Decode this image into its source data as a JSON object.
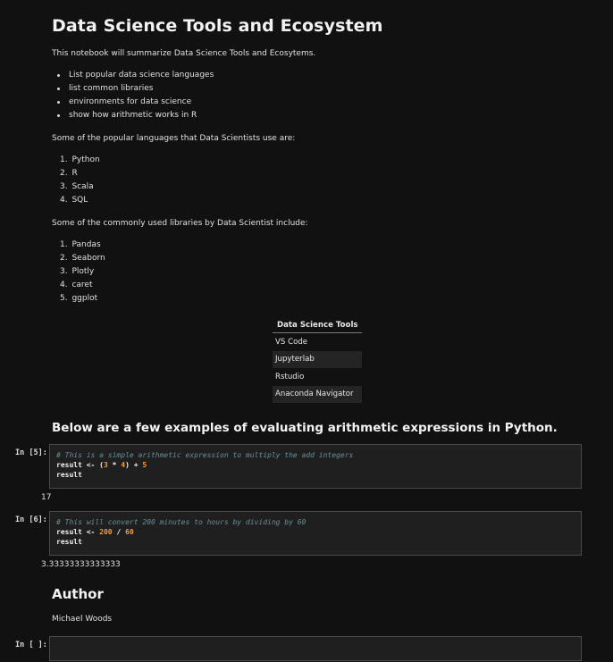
{
  "notebook": {
    "title": "Data Science Tools and Ecosystem",
    "intro": "This notebook will summarize Data Science Tools and Ecosytems.",
    "objectives": [
      "List popular data science languages",
      "list common libraries",
      "environments for data science",
      "show how arithmetic works in R"
    ],
    "languages_intro": "Some of the popular languages that Data Scientists use are:",
    "languages": [
      "Python",
      "R",
      "Scala",
      "SQL"
    ],
    "libraries_intro": "Some of the commonly used libraries by Data Scientist include:",
    "libraries": [
      "Pandas",
      "Seaborn",
      "Plotly",
      "caret",
      "ggplot"
    ],
    "tools_table": {
      "header": "Data Science Tools",
      "rows": [
        "VS Code",
        "Jupyterlab",
        "Rstudio",
        "Anaconda Navigator"
      ]
    },
    "arith_heading": "Below are a few examples of evaluating arithmetic expressions in Python.",
    "cells": [
      {
        "prompt": "In [5]:",
        "comment": "# This is a simple arithmetic expression to multiply the add integers",
        "line2": [
          "result <- ",
          "(",
          "3",
          " * ",
          "4",
          ") + ",
          "5"
        ],
        "line3": "result",
        "output": "17"
      },
      {
        "prompt": "In [6]:",
        "comment": "# This will convert 200 minutes to hours by dividing by 60",
        "line2": [
          "result <- ",
          "200",
          " / ",
          "60"
        ],
        "line3": "result",
        "output": "3.33333333333333"
      }
    ],
    "author_heading": "Author",
    "author_name": "Michael Woods",
    "empty_prompt": "In [ ]:"
  }
}
